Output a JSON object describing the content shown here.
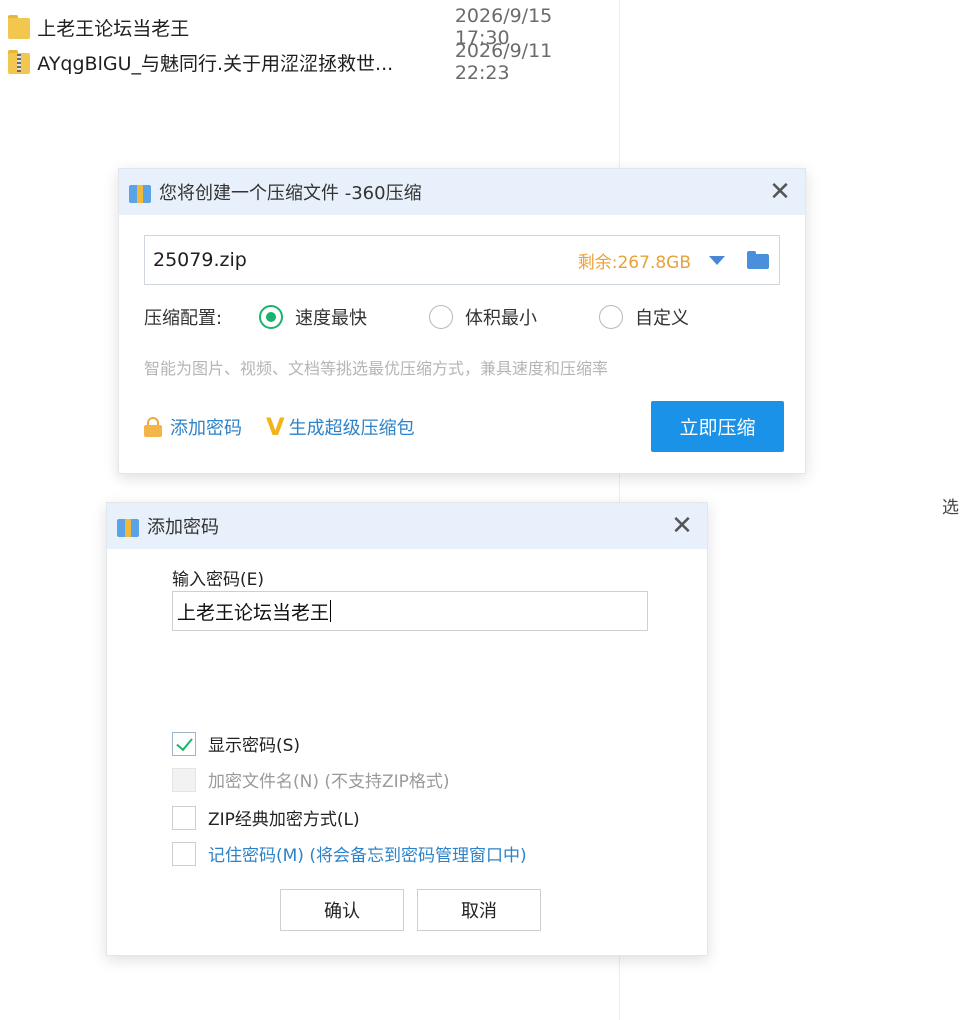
{
  "files": [
    {
      "name": "上老王论坛当老王",
      "date": "2026/9/15 17:30",
      "icon": "folder-icon"
    },
    {
      "name": "AYqgBlGU_与魅同行.关于用涩涩拯救世...",
      "date": "2026/9/11 22:23",
      "icon": "zip-archive-icon"
    }
  ],
  "side_text": "选",
  "compress_dialog": {
    "title": "您将创建一个压缩文件 -360压缩",
    "close": "✕",
    "filename": "25079.zip",
    "remaining": "剩余:267.8GB",
    "config_label": "压缩配置:",
    "options": [
      "速度最快",
      "体积最小",
      "自定义"
    ],
    "selected_option": "速度最快",
    "hint": "智能为图片、视频、文档等挑选最优压缩方式，兼具速度和压缩率",
    "add_password": "添加密码",
    "super_package": "生成超级压缩包",
    "compress_now": "立即压缩",
    "colors": {
      "accent": "#1a92e8",
      "remaining": "#e8a23a",
      "radio": "#19b36b",
      "link": "#2d83c9"
    }
  },
  "password_dialog": {
    "title": "添加密码",
    "close": "✕",
    "input_label": "输入密码(E)",
    "password_value": "上老王论坛当老王",
    "show_password": "显示密码(S)",
    "show_password_checked": true,
    "encrypt_names": "加密文件名(N) (不支持ZIP格式)",
    "zip_classic": "ZIP经典加密方式(L)",
    "remember": "记住密码(M) (将会备忘到密码管理窗口中)",
    "ok": "确认",
    "cancel": "取消"
  }
}
